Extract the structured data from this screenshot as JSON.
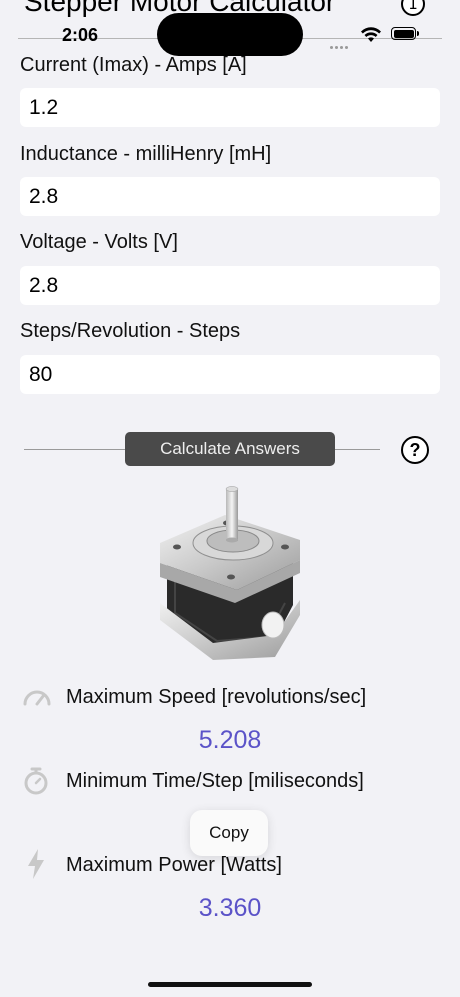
{
  "app": {
    "title": "Stepper Motor Calculator",
    "info_glyph": "1"
  },
  "status_bar": {
    "time": "2:06"
  },
  "fields": [
    {
      "label": "Current (Imax) - Amps [A]",
      "value": "1.2"
    },
    {
      "label": "Inductance - milliHenry [mH]",
      "value": "2.8"
    },
    {
      "label": "Voltage - Volts [V]",
      "value": "2.8"
    },
    {
      "label": "Steps/Revolution - Steps",
      "value": "80"
    }
  ],
  "actions": {
    "calculate_label": "Calculate Answers",
    "help_glyph": "?"
  },
  "results": [
    {
      "label": "Maximum Speed [revolutions/sec]",
      "value": "5.208",
      "icon": "speedometer-icon"
    },
    {
      "label": "Minimum Time/Step [miliseconds]",
      "value": "",
      "icon": "stopwatch-icon"
    },
    {
      "label": "Maximum Power [Watts]",
      "value": "3.360",
      "icon": "lightning-bolt-icon"
    }
  ],
  "context_menu": {
    "copy_label": "Copy"
  },
  "colors": {
    "result_value": "#5b53c8",
    "button_bg": "#4a4a4a",
    "background": "#f2f2f6"
  }
}
